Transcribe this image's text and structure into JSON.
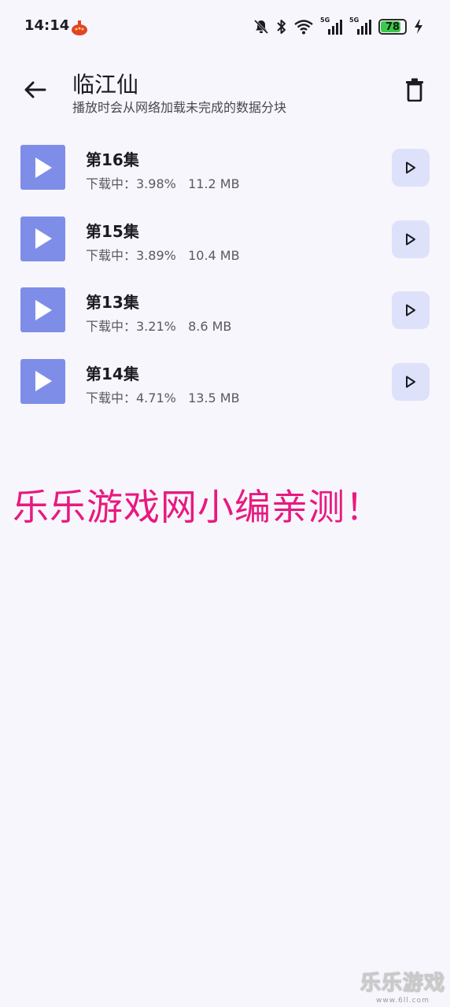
{
  "status_bar": {
    "time": "14:14",
    "signal_label_1": "5G",
    "signal_label_2": "5G",
    "battery_level": "78",
    "battery_color": "#3bc94a"
  },
  "header": {
    "title": "临江仙",
    "subtitle": "播放时会从网络加载未完成的数据分块",
    "back_icon": "arrow-left-icon",
    "delete_icon": "trash-icon"
  },
  "episodes": [
    {
      "title": "第16集",
      "status": "下载中：3.98%   11.2 MB",
      "progress_percent": 3.98
    },
    {
      "title": "第15集",
      "status": "下载中：3.89%   10.4 MB",
      "progress_percent": 3.89
    },
    {
      "title": "第13集",
      "status": "下载中：3.21%   8.6 MB",
      "progress_percent": 3.21
    },
    {
      "title": "第14集",
      "status": "下载中：4.71%   13.5 MB",
      "progress_percent": 4.71
    }
  ],
  "watermark": {
    "promo_text": "乐乐游戏网小编亲测！",
    "brand_name": "乐乐游戏",
    "brand_url": "www.6ll.com",
    "promo_color": "#e8197f"
  },
  "colors": {
    "accent_thumb": "#7e8ee8",
    "play_button_bg": "#dde1fa",
    "background": "#f7f6fd"
  }
}
